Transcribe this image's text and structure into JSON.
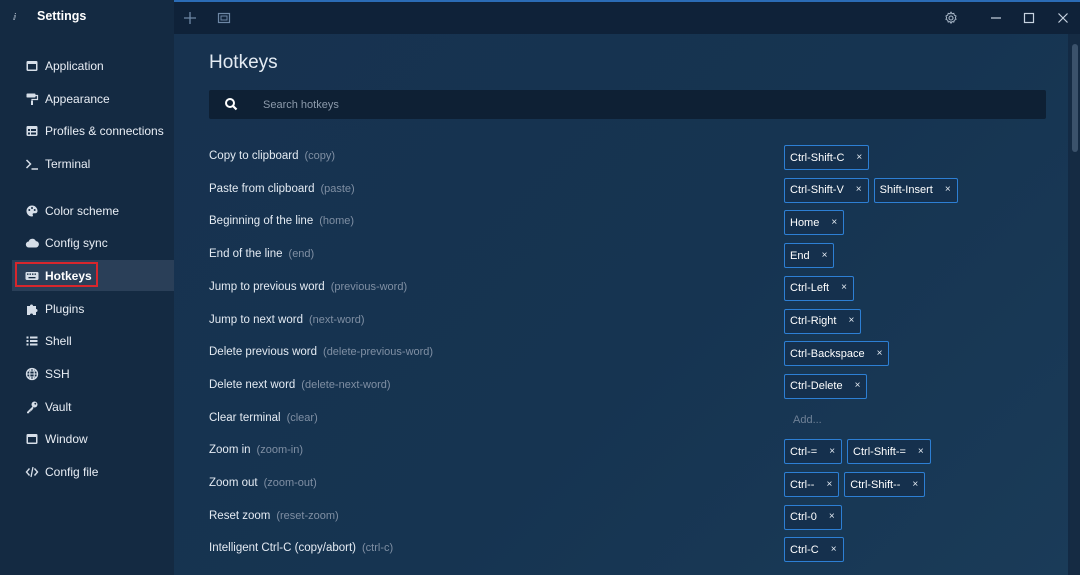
{
  "window": {
    "title": "Settings",
    "logo_glyph": "ⅈ"
  },
  "sidebar": {
    "items": [
      {
        "label": "Application",
        "icon": "window-icon"
      },
      {
        "label": "Appearance",
        "icon": "paint-roller-icon"
      },
      {
        "label": "Profiles & connections",
        "icon": "window-list-icon"
      },
      {
        "label": "Terminal",
        "icon": "terminal-icon"
      },
      {
        "label": "Color scheme",
        "icon": "palette-icon"
      },
      {
        "label": "Config sync",
        "icon": "cloud-icon"
      },
      {
        "label": "Hotkeys",
        "icon": "keyboard-icon",
        "active": true
      },
      {
        "label": "Plugins",
        "icon": "puzzle-icon"
      },
      {
        "label": "Shell",
        "icon": "list-icon"
      },
      {
        "label": "SSH",
        "icon": "globe-icon"
      },
      {
        "label": "Vault",
        "icon": "key-icon"
      },
      {
        "label": "Window",
        "icon": "window-icon"
      },
      {
        "label": "Config file",
        "icon": "code-icon"
      }
    ]
  },
  "topbar": {
    "new_tab_icon": "plus-icon",
    "tabs_icon": "tabs-icon",
    "settings_icon": "gear-icon",
    "minimize_icon": "minimize-icon",
    "maximize_icon": "maximize-icon",
    "close_icon": "close-icon"
  },
  "main": {
    "title": "Hotkeys",
    "search_placeholder": "Search hotkeys",
    "add_label": "Add...",
    "hotkeys": [
      {
        "name": "Copy to clipboard",
        "id": "(copy)",
        "keys": [
          "Ctrl-Shift-C"
        ]
      },
      {
        "name": "Paste from clipboard",
        "id": "(paste)",
        "keys": [
          "Ctrl-Shift-V",
          "Shift-Insert"
        ]
      },
      {
        "name": "Beginning of the line",
        "id": "(home)",
        "keys": [
          "Home"
        ]
      },
      {
        "name": "End of the line",
        "id": "(end)",
        "keys": [
          "End"
        ]
      },
      {
        "name": "Jump to previous word",
        "id": "(previous-word)",
        "keys": [
          "Ctrl-Left"
        ]
      },
      {
        "name": "Jump to next word",
        "id": "(next-word)",
        "keys": [
          "Ctrl-Right"
        ]
      },
      {
        "name": "Delete previous word",
        "id": "(delete-previous-word)",
        "keys": [
          "Ctrl-Backspace"
        ]
      },
      {
        "name": "Delete next word",
        "id": "(delete-next-word)",
        "keys": [
          "Ctrl-Delete"
        ]
      },
      {
        "name": "Clear terminal",
        "id": "(clear)",
        "keys": []
      },
      {
        "name": "Zoom in",
        "id": "(zoom-in)",
        "keys": [
          "Ctrl-=",
          "Ctrl-Shift-="
        ]
      },
      {
        "name": "Zoom out",
        "id": "(zoom-out)",
        "keys": [
          "Ctrl--",
          "Ctrl-Shift--"
        ]
      },
      {
        "name": "Reset zoom",
        "id": "(reset-zoom)",
        "keys": [
          "Ctrl-0"
        ]
      },
      {
        "name": "Intelligent Ctrl-C (copy/abort)",
        "id": "(ctrl-c)",
        "keys": [
          "Ctrl-C"
        ]
      }
    ]
  },
  "colors": {
    "accent": "#2d7fd4",
    "highlight": "#d8262c",
    "sidebar_bg": "#142a42",
    "content_bg": "#17324f"
  }
}
